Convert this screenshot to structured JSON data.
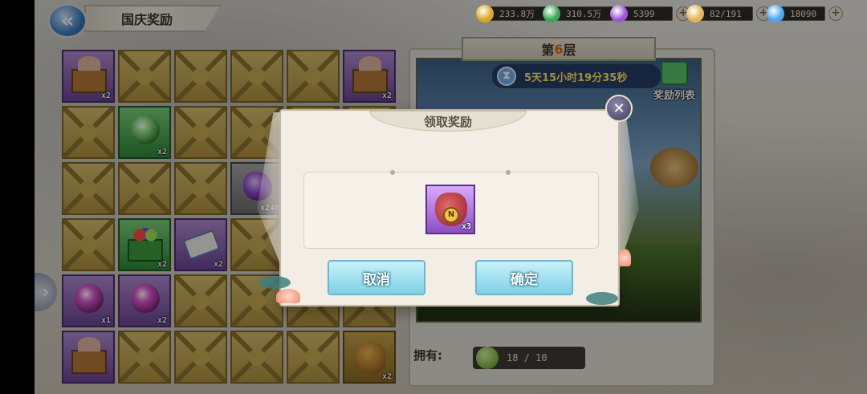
{
  "header": {
    "title": "国庆奖励",
    "back_glyph": "«"
  },
  "resources": [
    {
      "name": "gold-coin",
      "value": "233.8万",
      "color": "#d9a72a",
      "has_plus": false
    },
    {
      "name": "green-gem",
      "value": "310.5万",
      "color": "#3aa55a",
      "has_plus": false
    },
    {
      "name": "purple-orb",
      "value": "5399",
      "color": "#9b57d4",
      "has_plus": true
    },
    {
      "name": "stamina-wing",
      "value": "82/191",
      "color": "#e2b457",
      "has_plus": true
    },
    {
      "name": "diamond",
      "value": "18090",
      "color": "#4ea3f2",
      "has_plus": true
    }
  ],
  "grid": {
    "cells": [
      {
        "type": "purple",
        "icon": "gift-box-icon",
        "count": "x2"
      },
      {
        "type": "gold"
      },
      {
        "type": "gold"
      },
      {
        "type": "gold"
      },
      {
        "type": "gold"
      },
      {
        "type": "purple",
        "icon": "gift-box-icon",
        "count": "x2"
      },
      {
        "type": "gold"
      },
      {
        "type": "green",
        "icon": "green-orb-icon",
        "count": "x2"
      },
      {
        "type": "gold"
      },
      {
        "type": "gold"
      },
      {
        "type": "gold"
      },
      {
        "type": "gold"
      },
      {
        "type": "gold"
      },
      {
        "type": "gold"
      },
      {
        "type": "gold"
      },
      {
        "type": "gray",
        "icon": "purple-stone-icon",
        "count": "x240"
      },
      {
        "type": "gold"
      },
      {
        "type": "gold"
      },
      {
        "type": "gold"
      },
      {
        "type": "green",
        "icon": "fruit-box-icon",
        "count": "x2"
      },
      {
        "type": "purple",
        "icon": "scroll-icon",
        "count": "x2"
      },
      {
        "type": "gold"
      },
      {
        "type": "gold"
      },
      {
        "type": "gold"
      },
      {
        "type": "purple",
        "icon": "pink-orb-icon",
        "count": "x1"
      },
      {
        "type": "purple",
        "icon": "pink-orb-icon",
        "count": "x2"
      },
      {
        "type": "gold"
      },
      {
        "type": "gold"
      },
      {
        "type": "gold"
      },
      {
        "type": "gold"
      },
      {
        "type": "purple",
        "icon": "gift-box-icon",
        "count": ""
      },
      {
        "type": "gold"
      },
      {
        "type": "gold"
      },
      {
        "type": "gold"
      },
      {
        "type": "gold"
      },
      {
        "type": "gold2",
        "icon": "money-bag-icon",
        "count": "x2"
      }
    ]
  },
  "right_panel": {
    "floor_prefix": "第",
    "floor_number": "6",
    "floor_suffix": "层",
    "timer": "5天15小时19分35秒",
    "gift_list_label": "奖励列表",
    "own_label": "拥有:",
    "own_value": "18 / 10"
  },
  "modal": {
    "title": "领取奖励",
    "reward": {
      "icon": "coin-pouch-icon",
      "count": "x3",
      "coin_glyph": "N"
    },
    "cancel_label": "取消",
    "confirm_label": "确定",
    "close_glyph": "✕"
  },
  "side_arrow_glyph": "›"
}
